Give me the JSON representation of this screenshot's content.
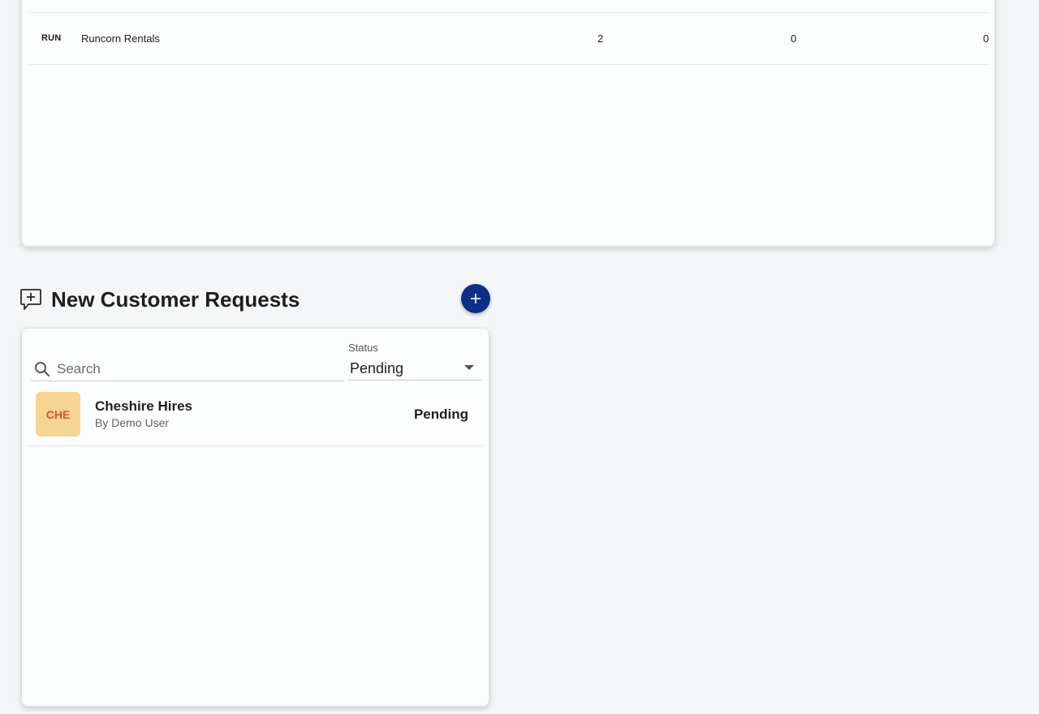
{
  "table": {
    "rows": [
      {
        "code": "RUN",
        "name": "Runcorn Rentals",
        "col1": "2",
        "col2": "0",
        "col3": "0"
      }
    ]
  },
  "requests": {
    "title": "New Customer Requests",
    "add_label": "+",
    "search": {
      "placeholder": "Search",
      "value": ""
    },
    "status_filter": {
      "label": "Status",
      "value": "Pending"
    },
    "items": [
      {
        "initials": "CHE",
        "name": "Cheshire Hires",
        "by": "By Demo User",
        "status": "Pending"
      }
    ]
  },
  "colors": {
    "accent": "#0b2f86",
    "avatar_bg": "#f6d592",
    "avatar_text": "#e1502b"
  },
  "icons": {
    "section": "add-comment-icon",
    "add": "plus-icon",
    "search": "search-icon",
    "dropdown": "caret-down-icon"
  }
}
